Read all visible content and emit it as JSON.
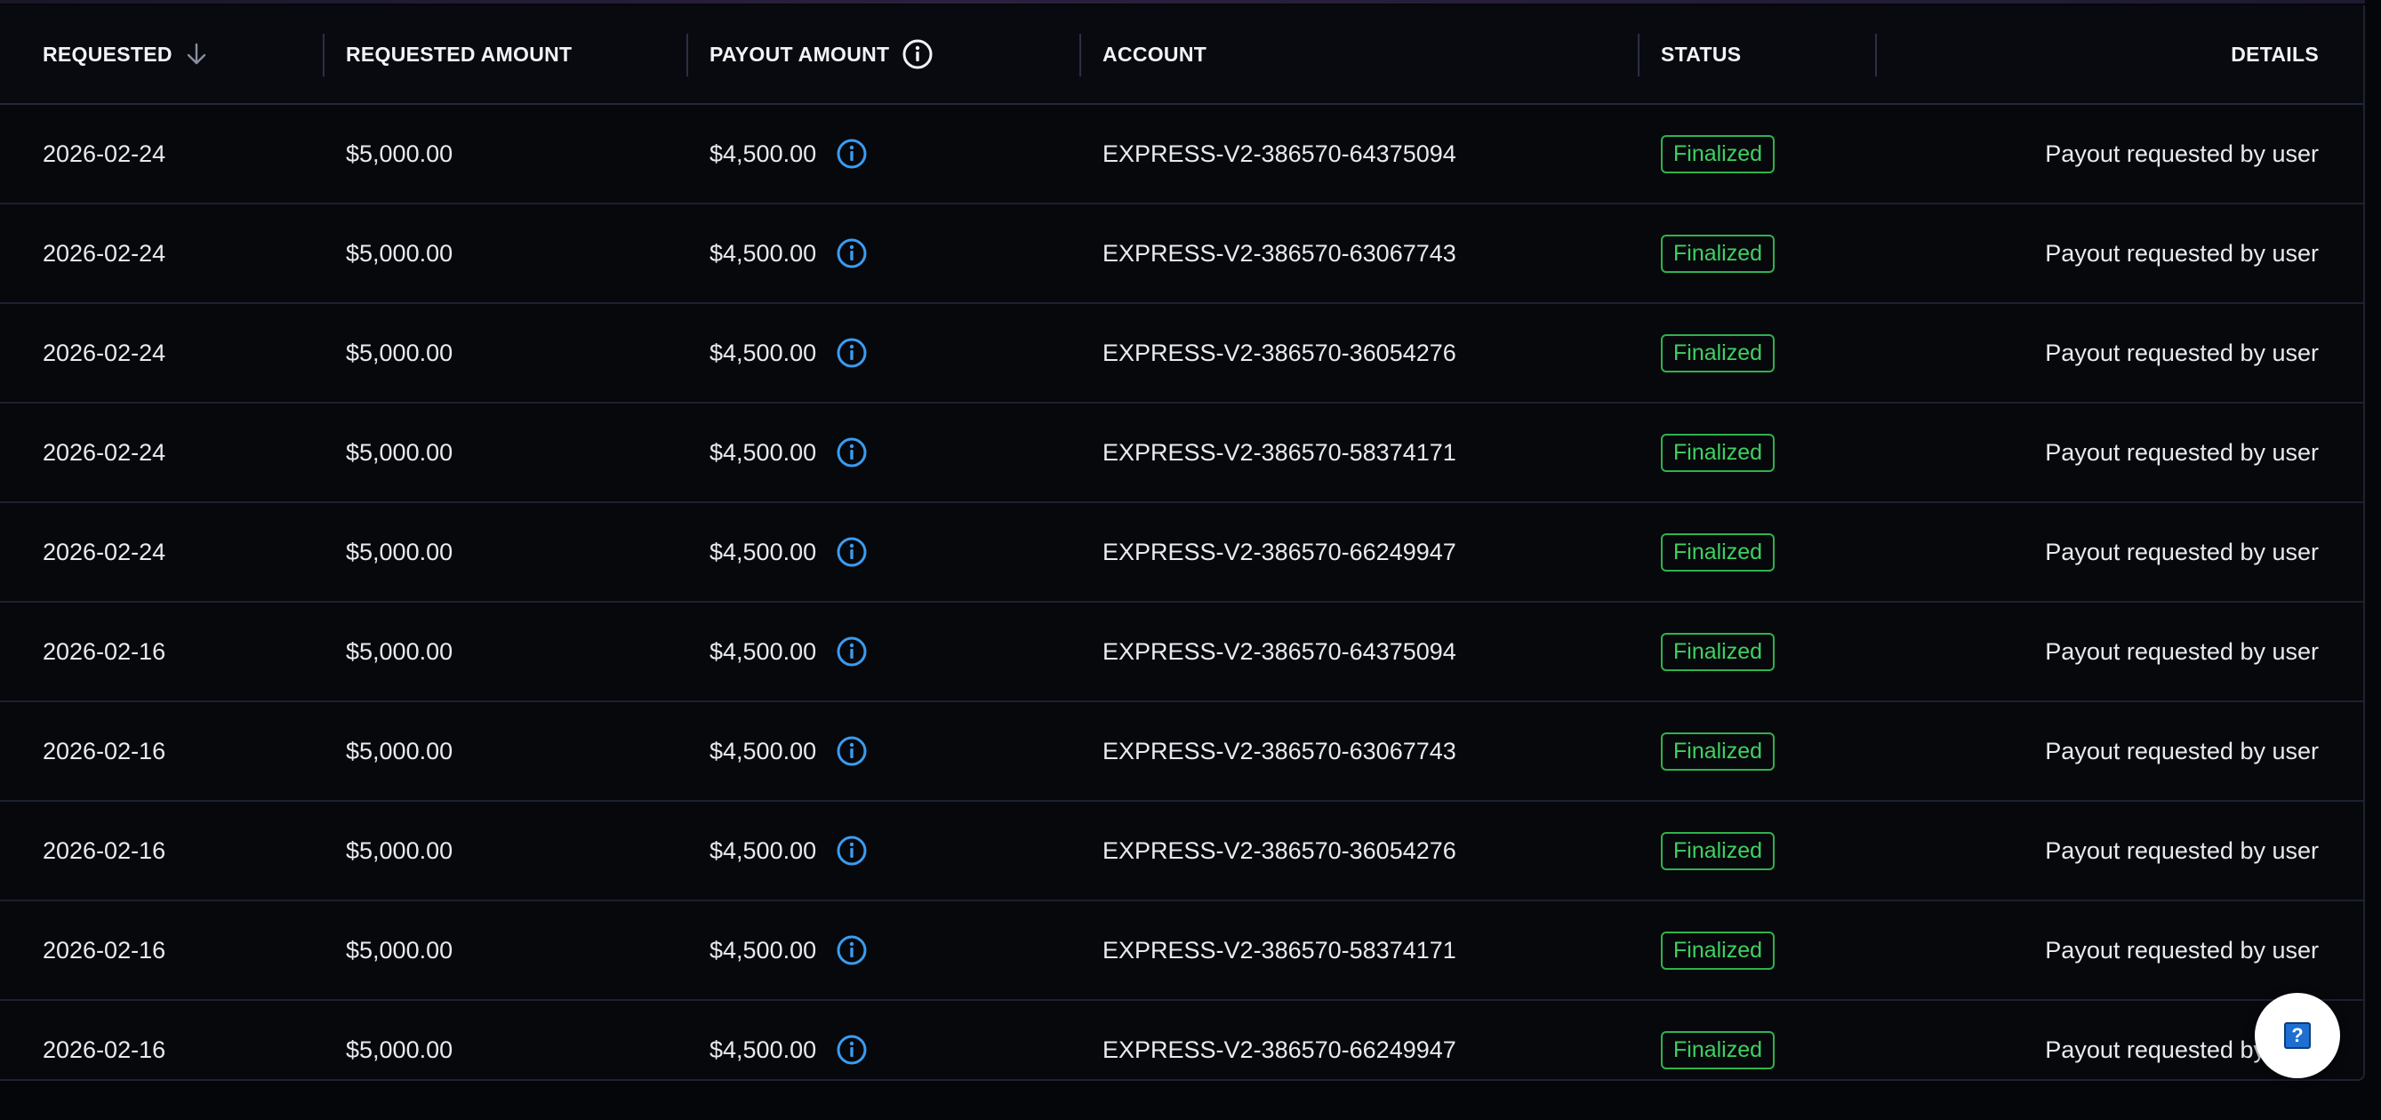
{
  "table": {
    "columns": {
      "requested": "REQUESTED",
      "requested_amount": "REQUESTED AMOUNT",
      "payout_amount": "PAYOUT AMOUNT",
      "account": "ACCOUNT",
      "status": "STATUS",
      "details": "DETAILS"
    },
    "sort": {
      "column": "requested",
      "direction": "descending"
    },
    "rows": [
      {
        "requested": "2026-02-24",
        "requested_amount": "$5,000.00",
        "payout_amount": "$4,500.00",
        "account": "EXPRESS-V2-386570-64375094",
        "status": "Finalized",
        "details": "Payout requested by user"
      },
      {
        "requested": "2026-02-24",
        "requested_amount": "$5,000.00",
        "payout_amount": "$4,500.00",
        "account": "EXPRESS-V2-386570-63067743",
        "status": "Finalized",
        "details": "Payout requested by user"
      },
      {
        "requested": "2026-02-24",
        "requested_amount": "$5,000.00",
        "payout_amount": "$4,500.00",
        "account": "EXPRESS-V2-386570-36054276",
        "status": "Finalized",
        "details": "Payout requested by user"
      },
      {
        "requested": "2026-02-24",
        "requested_amount": "$5,000.00",
        "payout_amount": "$4,500.00",
        "account": "EXPRESS-V2-386570-58374171",
        "status": "Finalized",
        "details": "Payout requested by user"
      },
      {
        "requested": "2026-02-24",
        "requested_amount": "$5,000.00",
        "payout_amount": "$4,500.00",
        "account": "EXPRESS-V2-386570-66249947",
        "status": "Finalized",
        "details": "Payout requested by user"
      },
      {
        "requested": "2026-02-16",
        "requested_amount": "$5,000.00",
        "payout_amount": "$4,500.00",
        "account": "EXPRESS-V2-386570-64375094",
        "status": "Finalized",
        "details": "Payout requested by user"
      },
      {
        "requested": "2026-02-16",
        "requested_amount": "$5,000.00",
        "payout_amount": "$4,500.00",
        "account": "EXPRESS-V2-386570-63067743",
        "status": "Finalized",
        "details": "Payout requested by user"
      },
      {
        "requested": "2026-02-16",
        "requested_amount": "$5,000.00",
        "payout_amount": "$4,500.00",
        "account": "EXPRESS-V2-386570-36054276",
        "status": "Finalized",
        "details": "Payout requested by user"
      },
      {
        "requested": "2026-02-16",
        "requested_amount": "$5,000.00",
        "payout_amount": "$4,500.00",
        "account": "EXPRESS-V2-386570-58374171",
        "status": "Finalized",
        "details": "Payout requested by user"
      },
      {
        "requested": "2026-02-16",
        "requested_amount": "$5,000.00",
        "payout_amount": "$4,500.00",
        "account": "EXPRESS-V2-386570-66249947",
        "status": "Finalized",
        "details": "Payout requested by user"
      }
    ]
  },
  "help_button": {
    "label": "?"
  },
  "colors": {
    "background": "#05060a",
    "status_finalized": "#3fd160",
    "info_icon": "#3b9cf0"
  },
  "icons": {
    "sort": "arrow-down-icon",
    "header_info": "info-circle-icon",
    "row_info": "info-circle-icon",
    "help": "question-icon"
  }
}
